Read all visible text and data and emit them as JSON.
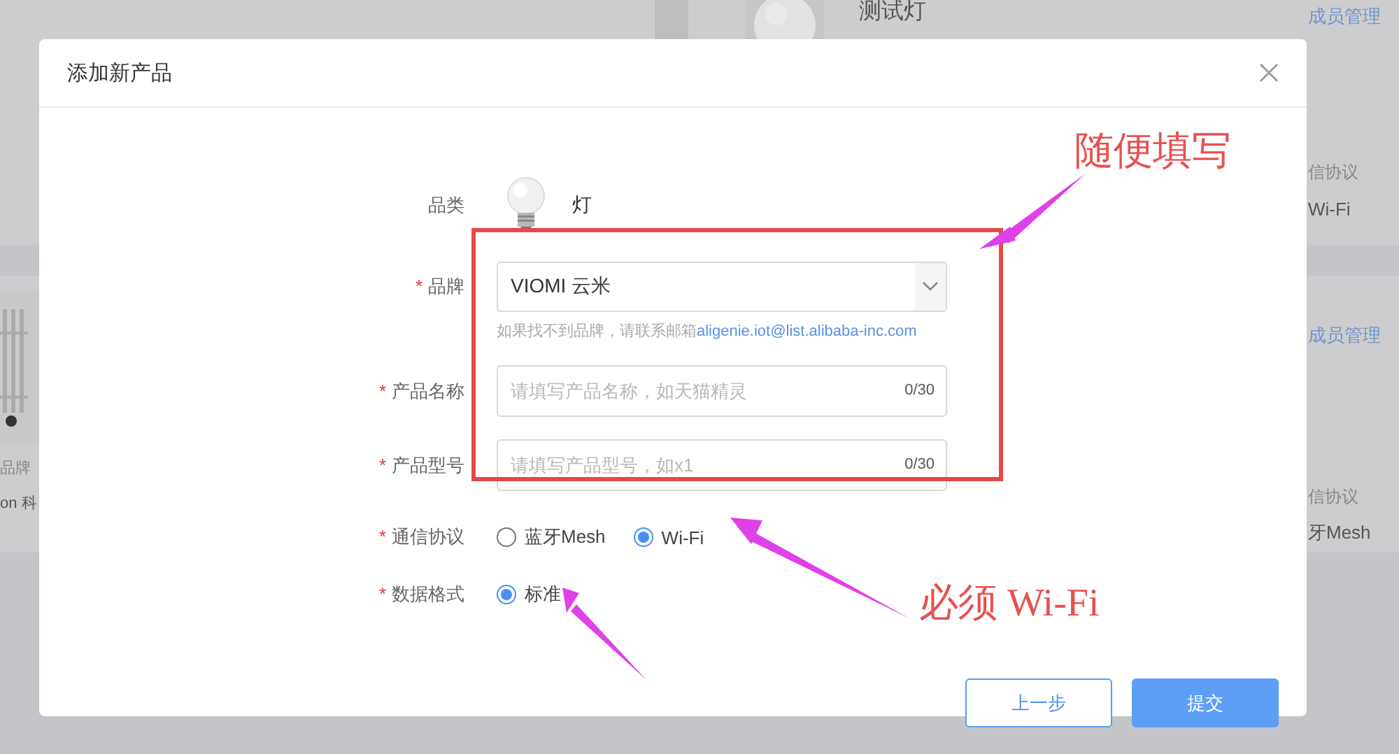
{
  "backdrop": {
    "cards": [
      {
        "title": "测试灯",
        "action": "成员管理",
        "protocol_label": "信协议",
        "protocol": "Wi-Fi"
      },
      {
        "brand_label": "品牌",
        "brand": "on 科",
        "action": "成员管理",
        "protocol_label": "信协议",
        "protocol": "牙Mesh"
      }
    ]
  },
  "dialog": {
    "title": "添加新产品",
    "fields": [
      {
        "kind": "category",
        "label": "品类",
        "value": "灯"
      },
      {
        "kind": "select",
        "label": "品牌",
        "required_mark": "*",
        "value": "VIOMI 云米",
        "hint": "如果找不到品牌，请联系邮箱",
        "hint_link": "aligenie.iot@list.alibaba-inc.com"
      },
      {
        "kind": "text",
        "label": "产品名称",
        "required_mark": "*",
        "placeholder": "请填写产品名称，如天猫精灵",
        "counter": "0/30"
      },
      {
        "kind": "text",
        "label": "产品型号",
        "required_mark": "*",
        "placeholder": "请填写产品型号，如x1",
        "counter": "0/30"
      },
      {
        "kind": "radio",
        "label": "通信协议",
        "required_mark": "*",
        "options": [
          {
            "label": "蓝牙Mesh",
            "selected": false
          },
          {
            "label": "Wi-Fi",
            "selected": true
          }
        ]
      },
      {
        "kind": "radio",
        "label": "数据格式",
        "required_mark": "*",
        "options": [
          {
            "label": "标准",
            "selected": true
          }
        ]
      }
    ],
    "buttons": [
      {
        "label": "上一步",
        "kind": "secondary"
      },
      {
        "label": "提交",
        "kind": "primary"
      }
    ]
  },
  "annotations": [
    {
      "text": "随便填写"
    },
    {
      "text": "必须 Wi-Fi"
    }
  ]
}
